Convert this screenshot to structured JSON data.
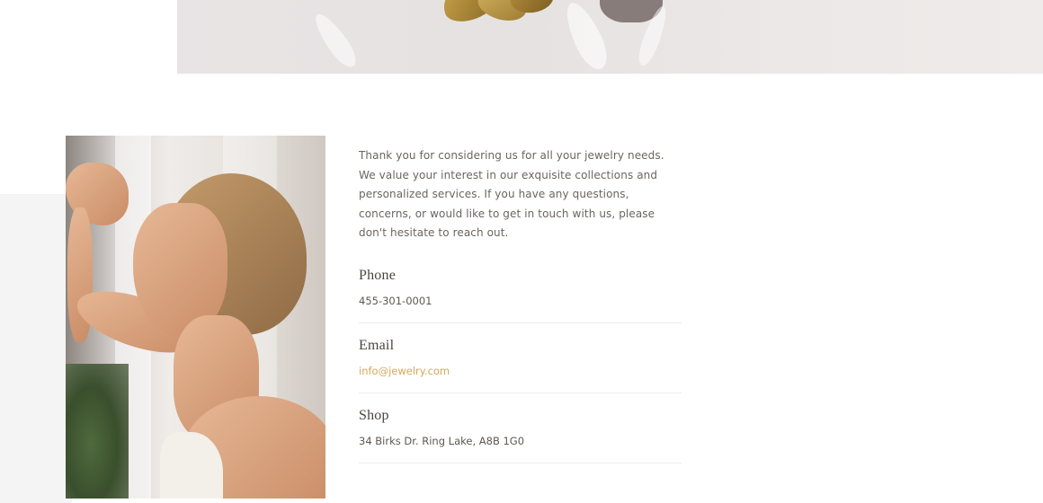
{
  "intro": {
    "lines": [
      "Thank you for considering us for all your jewelry needs.",
      "We value your interest in our exquisite collections and",
      "personalized services. If you have any questions,",
      "concerns, or would like to get in touch with us, please",
      "don't hesitate to reach out."
    ]
  },
  "contact": {
    "phone": {
      "label": "Phone",
      "value": "455-301-0001"
    },
    "email": {
      "label": "Email",
      "value": "info@jewelry.com"
    },
    "shop": {
      "label": "Shop",
      "value": "34 Birks Dr. Ring Lake, A8B 1G0"
    }
  },
  "colors": {
    "accent_link": "#d4a85a",
    "text": "#6b6560",
    "heading": "#4a4440"
  },
  "images": {
    "hero": "hero-banner-jewelry-image",
    "portrait": "portrait-woman-earrings-image"
  }
}
